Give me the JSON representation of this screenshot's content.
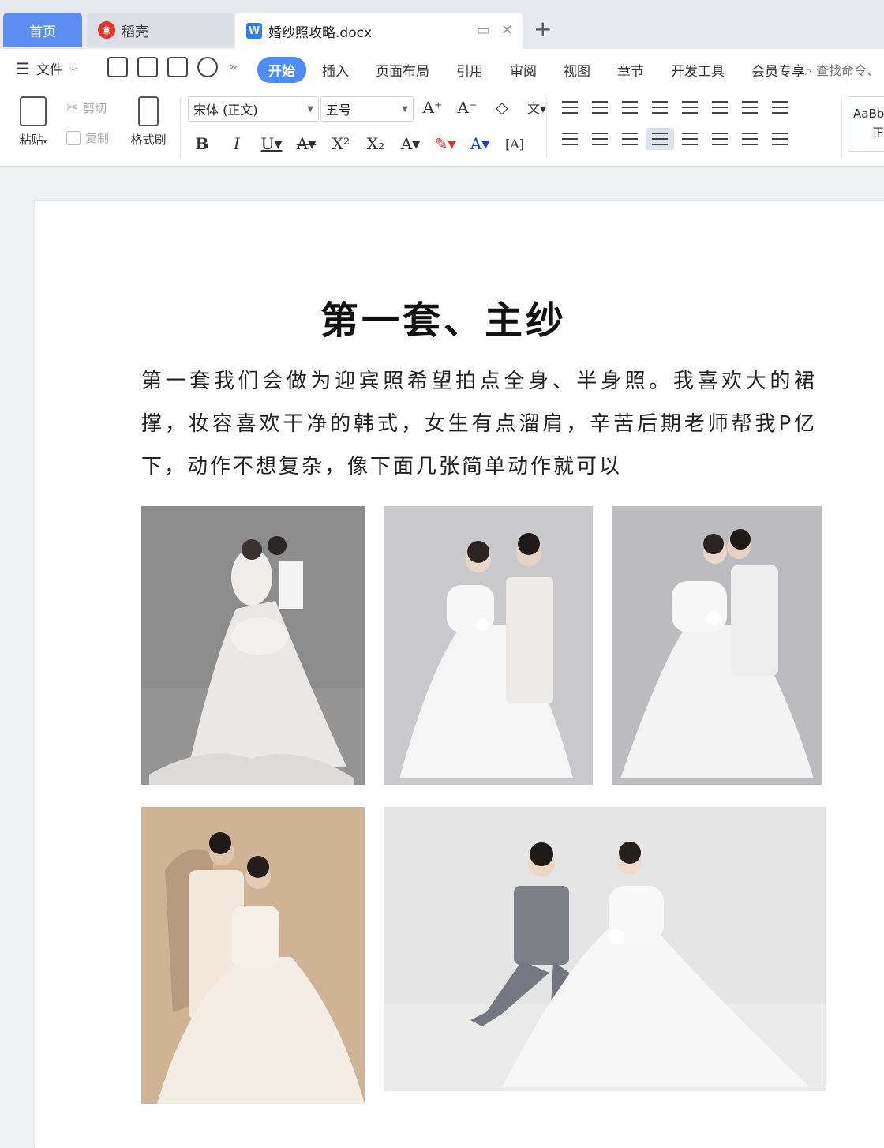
{
  "tabs": {
    "home": "首页",
    "daoke": "稻壳",
    "document": "婚纱照攻略.docx"
  },
  "menu": {
    "file": "文件",
    "tabs": [
      "开始",
      "插入",
      "页面布局",
      "引用",
      "审阅",
      "视图",
      "章节",
      "开发工具",
      "会员专享"
    ],
    "active_tab": "开始",
    "search": "查找命令、"
  },
  "ribbon": {
    "paste": "粘贴",
    "cut": "剪切",
    "copy": "复制",
    "format_painter": "格式刷",
    "font_name": "宋体 (正文)",
    "font_size": "五号",
    "style_preview": "AaBbC",
    "style_preview2": "正文"
  },
  "document": {
    "title": "第一套、主纱",
    "paragraph": "第一套我们会做为迎宾照希望拍点全身、半身照。我喜欢大的裙撑，妆容喜欢干净的韩式，女生有点溜肩，辛苦后期老师帮我P亿下，动作不想复杂，像下面几张简单动作就可以",
    "photos": [
      {
        "name": "photo-1",
        "background": "#8c8c8c"
      },
      {
        "name": "photo-2",
        "background": "#c9c8ca"
      },
      {
        "name": "photo-3",
        "background": "#bcbbbd"
      },
      {
        "name": "photo-4",
        "background": "#c9a98a"
      },
      {
        "name": "photo-5",
        "background": "#e5e5e6"
      }
    ]
  },
  "colors": {
    "accent": "#4f8cf5",
    "home_tab": "#5b8ef0"
  }
}
